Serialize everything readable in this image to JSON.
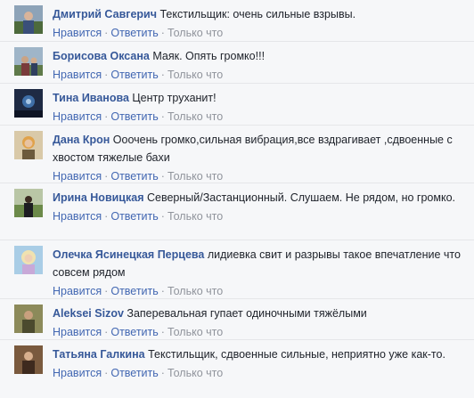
{
  "actions": {
    "like_label": "Нравится",
    "reply_label": "Ответить",
    "separator": "·"
  },
  "comments": [
    {
      "author": "Дмитрий Савгерич",
      "text": "Текстильщик: очень сильные взрывы.",
      "time": "Только что"
    },
    {
      "author": "Борисова Оксана",
      "text": "Маяк. Опять громко!!!",
      "time": "Только что"
    },
    {
      "author": "Тина Иванова",
      "text": "Центр труханит!",
      "time": "Только что"
    },
    {
      "author": "Дана Крон",
      "text": "Ооочень громко,сильная вибрация,все вздрагивает ,сдвоенные с хвостом тяжелые бахи",
      "time": "Только что"
    },
    {
      "author": "Ирина Новицкая",
      "text": "Северный/Застанционный. Слушаем. Не рядом, но громко.",
      "time": "Только что"
    },
    {
      "author": "Олечка Ясинецкая Перцева",
      "text": "лидиевка свит и разрывы такое впечатление что совсем рядом",
      "time": "Только что"
    },
    {
      "author": "Aleksei Sizov",
      "text": "Заперевальная гупает одиночными тяжёлыми",
      "time": "Только что"
    },
    {
      "author": "Татьяна Галкина",
      "text": "Текстильщик, сдвоенные сильные, неприятно уже как-то.",
      "time": "Только что"
    }
  ],
  "colors": {
    "author": "#365899",
    "link": "#4267b2",
    "meta": "#90949c",
    "text": "#1d2129",
    "background": "#f6f7f9"
  }
}
